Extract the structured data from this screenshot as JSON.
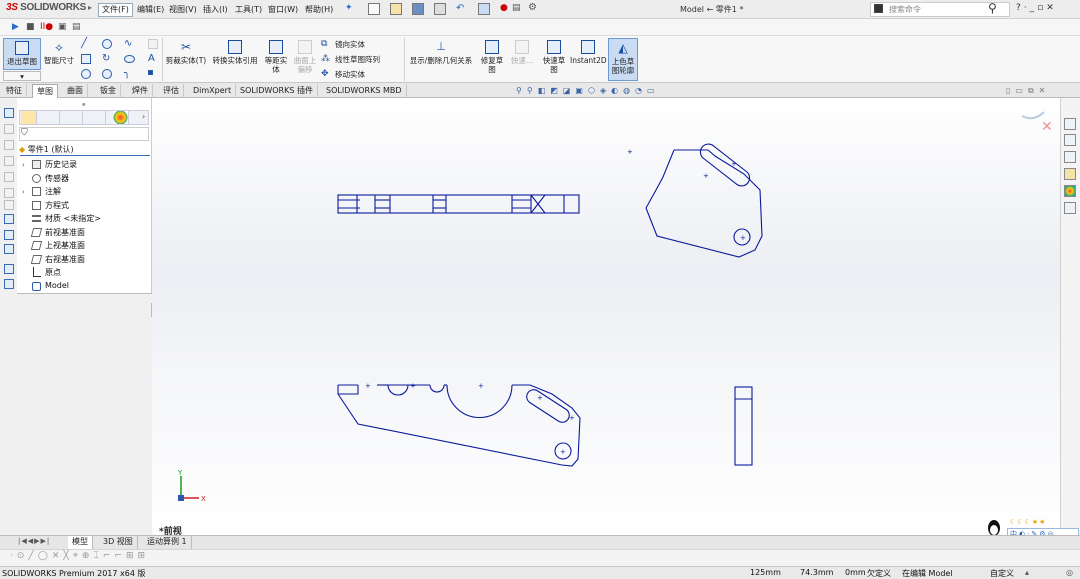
{
  "app": {
    "logo_prefix": "3S",
    "logo_text": "SOLIDWORKS"
  },
  "menu": [
    "文件(F)",
    "编辑(E)",
    "视图(V)",
    "插入(I)",
    "工具(T)",
    "窗口(W)",
    "帮助(H)"
  ],
  "title": "Model ← 零件1 *",
  "search": {
    "placeholder": "搜索命令"
  },
  "ribbon": {
    "exit_sketch": "退出草图",
    "smart_dim": "智能尺寸",
    "trim": "剪裁实体(T)",
    "convert": "转换实体引用",
    "offset": "等距实\n体",
    "surface_offset": "曲面上\n偏移",
    "mirror": "镜向实体",
    "linear_pattern": "线性草图阵列",
    "move": "移动实体",
    "display_relations": "显示/删除几何关系",
    "repair": "修复草\n图",
    "quick_snap": "快速...",
    "rapid_sketch": "快速草\n图",
    "instant2d": "Instant2D",
    "shaded_sketch": "上色草\n图轮廓"
  },
  "tabs": [
    "特征",
    "草图",
    "曲面",
    "钣金",
    "焊件",
    "评估",
    "DimXpert",
    "SOLIDWORKS 插件",
    "SOLIDWORKS MBD"
  ],
  "active_tab": "草图",
  "tree": {
    "root": "零件1  (默认)",
    "items": [
      "历史记录",
      "传感器",
      "注解",
      "方程式",
      "材质 <未指定>",
      "前视基准面",
      "上视基准面",
      "右视基准面",
      "原点",
      "Model"
    ]
  },
  "view_name": "*前视",
  "axis": {
    "y": "Y",
    "x": "X"
  },
  "bottom_tabs": [
    "模型",
    "3D 视图",
    "运动算例 1"
  ],
  "status": {
    "product": "SOLIDWORKS Premium 2017 x64 版",
    "x": "125mm",
    "y": "74.3mm",
    "z": "0mm",
    "defined": "欠定义",
    "editing": "在编辑 Model",
    "units": "自定义"
  },
  "ime": {
    "label": "中"
  },
  "colors": {
    "sketch_line": "#0a1a9c",
    "accent": "#c00000",
    "selected": "#c9dcf3"
  }
}
